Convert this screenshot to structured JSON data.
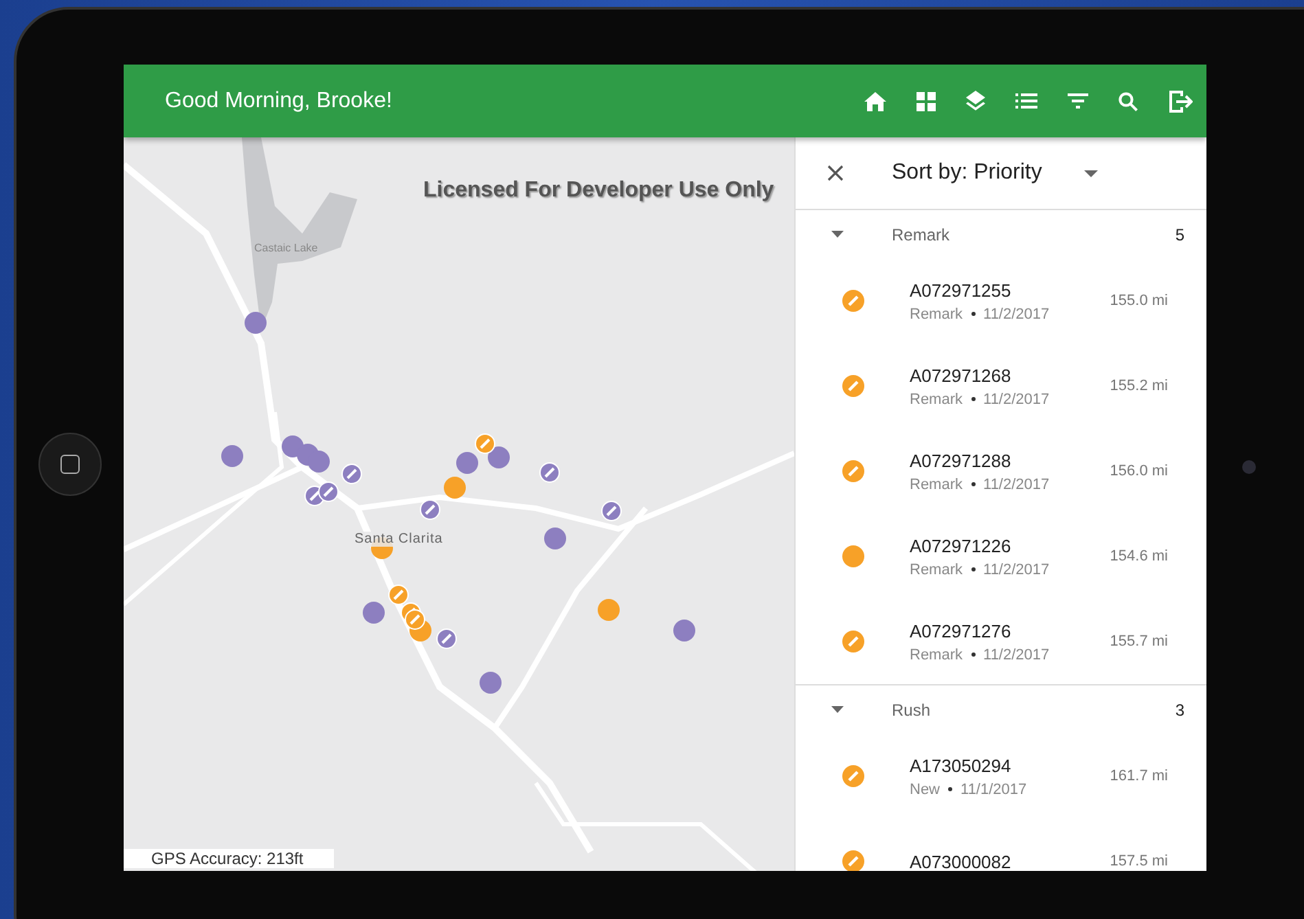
{
  "header": {
    "greeting": "Good Morning, Brooke!"
  },
  "map": {
    "watermark": "Licensed For Developer Use Only",
    "labels": [
      "Castaic Lake",
      "Santa Clarita"
    ],
    "gps_accuracy": "GPS Accuracy: 213ft"
  },
  "panel": {
    "sort_label": "Sort by: Priority",
    "groups": [
      {
        "name": "Remark",
        "count": "5",
        "expanded": true,
        "items": [
          {
            "id": "A072971255",
            "status": "Remark",
            "date": "11/2/2017",
            "distance": "155.0 mi",
            "kind": "edit"
          },
          {
            "id": "A072971268",
            "status": "Remark",
            "date": "11/2/2017",
            "distance": "155.2 mi",
            "kind": "edit"
          },
          {
            "id": "A072971288",
            "status": "Remark",
            "date": "11/2/2017",
            "distance": "156.0 mi",
            "kind": "edit"
          },
          {
            "id": "A072971226",
            "status": "Remark",
            "date": "11/2/2017",
            "distance": "154.6 mi",
            "kind": "plain"
          },
          {
            "id": "A072971276",
            "status": "Remark",
            "date": "11/2/2017",
            "distance": "155.7 mi",
            "kind": "edit"
          }
        ]
      },
      {
        "name": "Rush",
        "count": "3",
        "expanded": true,
        "items": [
          {
            "id": "A173050294",
            "status": "New",
            "date": "11/1/2017",
            "distance": "161.7 mi",
            "kind": "edit"
          },
          {
            "id": "A073000082",
            "distance": "157.5 mi",
            "kind": "edit"
          }
        ]
      }
    ]
  }
}
